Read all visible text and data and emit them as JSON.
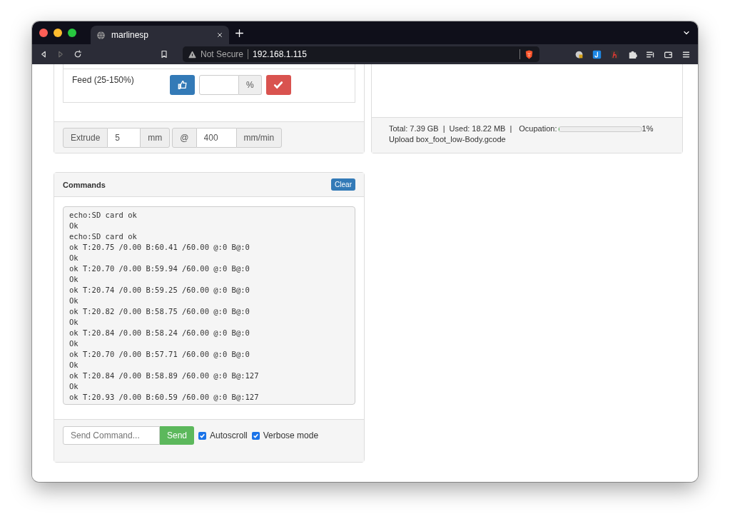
{
  "browser": {
    "tab": {
      "title": "marlinesp"
    },
    "address": {
      "security": "Not Secure",
      "url": "192.168.1.115"
    }
  },
  "feed": {
    "label": "Feed (25-150%)",
    "unit": "%"
  },
  "extrude": {
    "label": "Extrude",
    "distance": "5",
    "distance_unit": "mm",
    "at": "@",
    "speed": "400",
    "speed_unit": "mm/min"
  },
  "sd": {
    "total": "Total: 7.39 GB",
    "sep1": "|",
    "used": "Used: 18.22 MB",
    "sep2": "|",
    "occupation_label": "Ocupation:",
    "level": 0.01,
    "percent": "1%",
    "upload": "Upload box_foot_low-Body.gcode"
  },
  "commands": {
    "title": "Commands",
    "clear": "Clear",
    "log": [
      "echo:SD card ok",
      "Ok",
      "echo:SD card ok",
      "ok T:20.75 /0.00 B:60.41 /60.00 @:0 B@:0",
      "Ok",
      "ok T:20.70 /0.00 B:59.94 /60.00 @:0 B@:0",
      "Ok",
      "ok T:20.74 /0.00 B:59.25 /60.00 @:0 B@:0",
      "Ok",
      "ok T:20.82 /0.00 B:58.75 /60.00 @:0 B@:0",
      "Ok",
      "ok T:20.84 /0.00 B:58.24 /60.00 @:0 B@:0",
      "Ok",
      "ok T:20.70 /0.00 B:57.71 /60.00 @:0 B@:0",
      "Ok",
      "ok T:20.84 /0.00 B:58.89 /60.00 @:0 B@:127",
      "Ok",
      "ok T:20.93 /0.00 B:60.59 /60.00 @:0 B@:127"
    ],
    "input": {
      "placeholder": "Send Command..."
    },
    "send": "Send",
    "options": [
      {
        "label": "Autoscroll",
        "checked": true
      },
      {
        "label": "Verbose mode",
        "checked": true
      }
    ]
  }
}
